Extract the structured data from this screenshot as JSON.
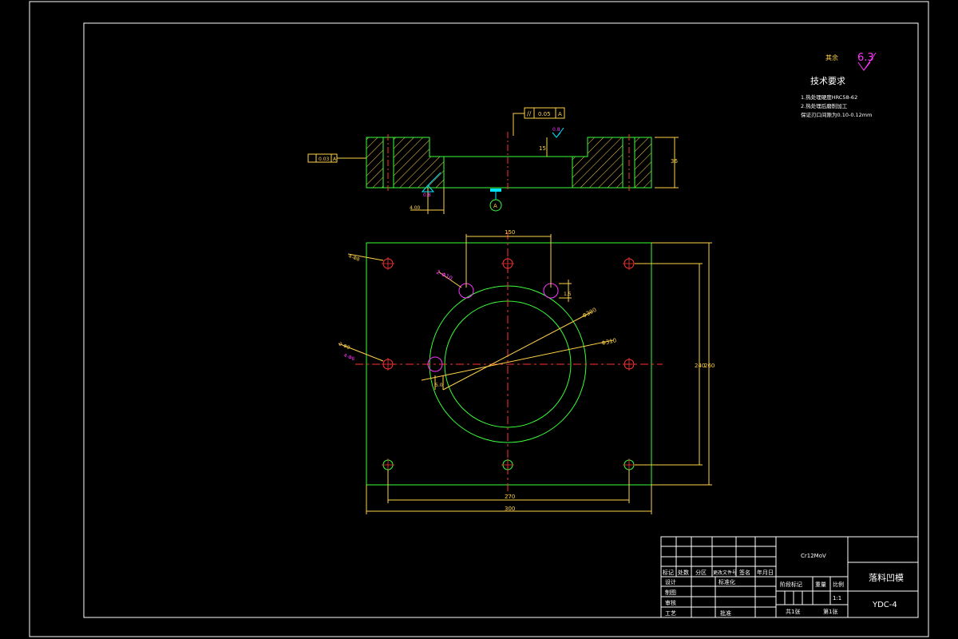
{
  "tech": {
    "rough_label": "其余",
    "rough_value": "6.3",
    "title": "技术要求",
    "line1": "1.热处理硬度HRC58-62",
    "line2": "2.热处理后磨削加工",
    "line3": "保证刃口间隙为0.10-0.12mm"
  },
  "section": {
    "parallel_value": "0.05",
    "parallel_datum": "A",
    "perp_value": "0.03",
    "perp_datum": "A",
    "rough_top": "0.8",
    "rough_side": "0.8",
    "dim_depth": "15",
    "dim_thickness": "36",
    "dim_offset": "4.00",
    "datum": "A"
  },
  "plan": {
    "dim_top": "150",
    "dim_hole_spacing": "4-Φ8",
    "dim_small_holes": "2-Φ10",
    "dim_hole_offset": "1.5",
    "dim_diam1": "Φ300",
    "dim_diam2": "Φ310",
    "dim_side_holes": "2-Φ8",
    "dim_side_holes2": "4-Φ6",
    "dim_radius": "5.0",
    "dim_inner_height": "240",
    "dim_outer_height": "260",
    "dim_inner_width": "270",
    "dim_outer_width": "300"
  },
  "titleblock": {
    "material": "Cr12MoV",
    "part_name": "落料凹模",
    "drawing_no": "YDC-4",
    "h_mark": "标记",
    "h_qty": "处数",
    "h_zone": "分区",
    "h_doc": "更改文件号",
    "h_sign": "签名",
    "h_date": "年月日",
    "r_design": "设计",
    "r_std": "标准化",
    "r_draw": "制图",
    "r_check": "审核",
    "r_process": "工艺",
    "r_approve": "批准",
    "h_stage": "阶段标记",
    "h_weight": "重量",
    "h_scale": "比例",
    "scale": "1:1",
    "sheets_total": "共1张",
    "sheet_no": "第1张"
  }
}
